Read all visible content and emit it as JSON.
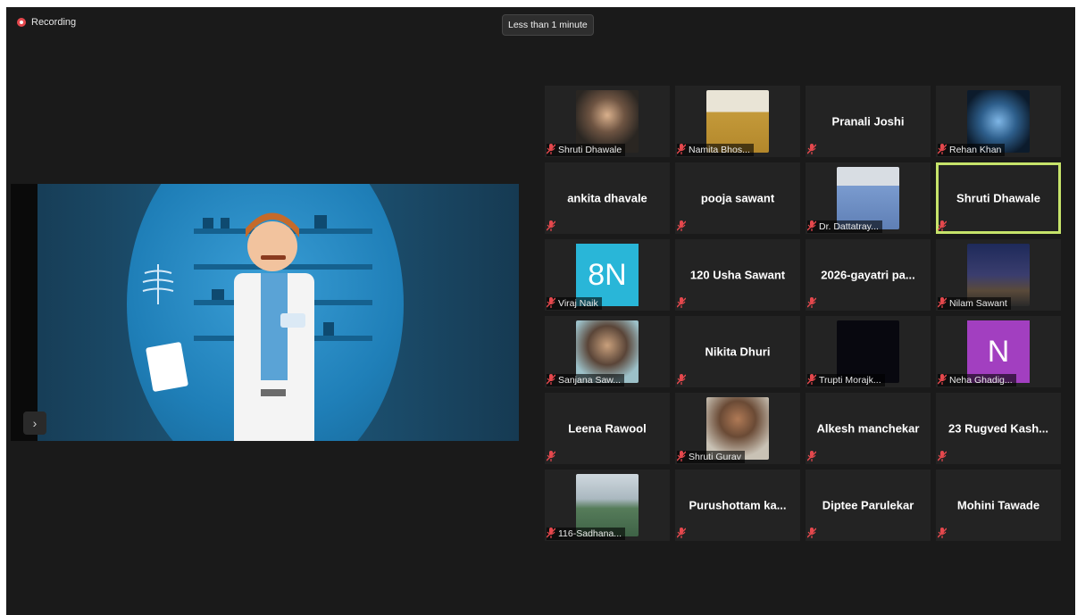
{
  "recording": {
    "label": "Recording"
  },
  "timer": {
    "label": "Less than 1 minute"
  },
  "share": {
    "next_icon": "chevron-right-icon"
  },
  "colors": {
    "active_border": "#c6e36a",
    "mute_red": "#e5484d",
    "tile_bg": "#232323"
  },
  "participants": [
    {
      "name": "Shruti Dhawale",
      "label": "Shruti Dhawale",
      "kind": "photo",
      "photo": "portrait-woman-dark"
    },
    {
      "name": "Namita Bhosale",
      "label": "Namita Bhos...",
      "kind": "photo",
      "photo": "portrait-woman-yellow"
    },
    {
      "name": "Pranali Joshi",
      "label": "",
      "kind": "name"
    },
    {
      "name": "Rehan Khan",
      "label": "Rehan Khan",
      "kind": "photo",
      "photo": "wings-art"
    },
    {
      "name": "ankita dhavale",
      "label": "",
      "kind": "name"
    },
    {
      "name": "pooja sawant",
      "label": "",
      "kind": "name"
    },
    {
      "name": "Dr. Dattatray",
      "label": "Dr. Dattatray...",
      "kind": "photo",
      "photo": "portrait-man-tie"
    },
    {
      "name": "Shruti Dhawale",
      "label": "",
      "kind": "name",
      "active": true
    },
    {
      "name": "Viraj Naik",
      "label": "Viraj Naik",
      "kind": "avatar",
      "avatar_text": "8N",
      "avatar_color": "#29b6d8"
    },
    {
      "name": "120 Usha Sawant",
      "label": "",
      "kind": "name"
    },
    {
      "name": "2026-gayatri pa...",
      "label": "",
      "kind": "name"
    },
    {
      "name": "Nilam Sawant",
      "label": "Nilam Sawant",
      "kind": "photo",
      "photo": "night-scene"
    },
    {
      "name": "Sanjana Sawant",
      "label": "Sanjana Saw...",
      "kind": "photo",
      "photo": "portrait-girl"
    },
    {
      "name": "Nikita Dhuri",
      "label": "",
      "kind": "name"
    },
    {
      "name": "Trupti Morajkar",
      "label": "Trupti Morajk...",
      "kind": "photo",
      "photo": "dark-video"
    },
    {
      "name": "Neha Ghadigaonkar",
      "label": "Neha Ghadig...",
      "kind": "avatar",
      "avatar_text": "N",
      "avatar_color": "#a23fc0"
    },
    {
      "name": "Leena Rawool",
      "label": "",
      "kind": "name"
    },
    {
      "name": "Shruti Gurav",
      "label": "Shruti Gurav",
      "kind": "photo",
      "photo": "portrait-girl-outdoor"
    },
    {
      "name": "Alkesh manchekar",
      "label": "",
      "kind": "name"
    },
    {
      "name": "23 Rugved Kash...",
      "label": "",
      "kind": "name"
    },
    {
      "name": "116-Sadhana",
      "label": "116-Sadhana...",
      "kind": "photo",
      "photo": "coast-landscape"
    },
    {
      "name": "Purushottam ka...",
      "label": "",
      "kind": "name"
    },
    {
      "name": "Diptee Parulekar",
      "label": "",
      "kind": "name"
    },
    {
      "name": "Mohini Tawade",
      "label": "",
      "kind": "name"
    }
  ]
}
